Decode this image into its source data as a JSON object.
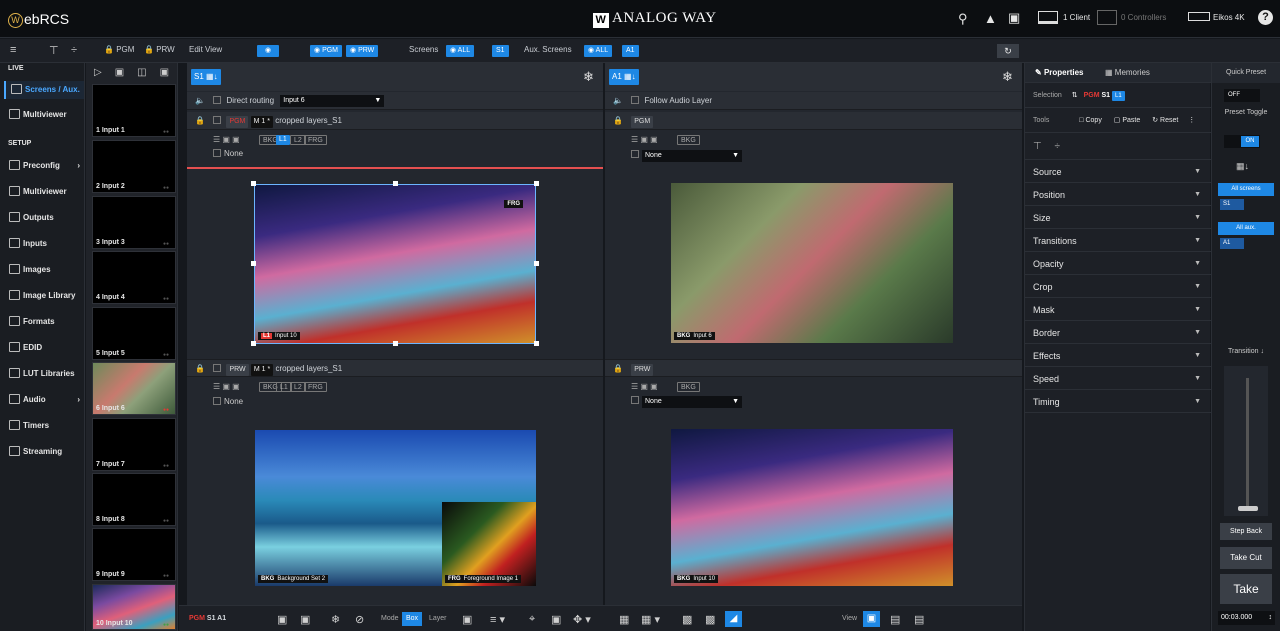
{
  "app": {
    "name": "ebRCS",
    "brand": "ANALOG WAY",
    "clients": "1 Client",
    "controllers": "0 Controllers",
    "device": "Eikos 4K"
  },
  "toolbar": {
    "pgm": "PGM",
    "prw": "PRW",
    "edit_view": "Edit View",
    "pgm_btn": "PGM",
    "prw_btn": "PRW",
    "screens_label": "Screens",
    "all": "ALL",
    "s1": "S1",
    "aux_label": "Aux. Screens",
    "aux_all": "ALL",
    "a1": "A1"
  },
  "nav": {
    "live": "LIVE",
    "setup": "SETUP",
    "items": [
      {
        "label": "Screens / Aux."
      },
      {
        "label": "Multiviewer"
      },
      {
        "label": "Preconfig"
      },
      {
        "label": "Multiviewer"
      },
      {
        "label": "Outputs"
      },
      {
        "label": "Inputs"
      },
      {
        "label": "Images"
      },
      {
        "label": "Image Library"
      },
      {
        "label": "Formats"
      },
      {
        "label": "EDID"
      },
      {
        "label": "LUT Libraries"
      },
      {
        "label": "Audio"
      },
      {
        "label": "Timers"
      },
      {
        "label": "Streaming"
      }
    ]
  },
  "inputs": [
    "1 Input 1",
    "2 Input 2",
    "3 Input 3",
    "4 Input 4",
    "5 Input 5",
    "6 Input 6",
    "7 Input 7",
    "8 Input 8",
    "9 Input 9",
    "10 Input 10"
  ],
  "s1": {
    "title": "S1",
    "routing": "Direct routing",
    "routing_value": "Input 6",
    "pgm": "PGM",
    "mem": "M 1 *",
    "mem_name": "cropped layers_S1",
    "layers": [
      "BKG",
      "L1",
      "L2",
      "FRG"
    ],
    "none": "None",
    "frg": "FRG",
    "l1": "L1",
    "l1_input": "Input 10",
    "prw": "PRW",
    "prw_mem": "M 1 *",
    "prw_mem_name": "cropped layers_S1",
    "prw_none": "None",
    "bkg": "BKG",
    "bkg_name": "Background Set 2",
    "frg_name": "Foreground Image 1"
  },
  "a1": {
    "title": "A1",
    "follow": "Follow Audio Layer",
    "pgm": "PGM",
    "bkg": "BKG",
    "none": "None",
    "bkg_input": "Input 6",
    "prw": "PRW",
    "prw_none": "None",
    "prw_bkg_input": "Input 10"
  },
  "props": {
    "tab_properties": "Properties",
    "tab_memories": "Memories",
    "selection": "Selection",
    "sel_pgm": "PGM",
    "sel_s1": "S1",
    "sel_l1": "L1",
    "tools": "Tools",
    "copy": "Copy",
    "paste": "Paste",
    "reset": "Reset",
    "sections": [
      "Source",
      "Position",
      "Size",
      "Transitions",
      "Opacity",
      "Crop",
      "Mask",
      "Border",
      "Effects",
      "Speed",
      "Timing"
    ]
  },
  "quick": {
    "title": "Quick Preset",
    "off": "OFF",
    "toggle": "Preset Toggle",
    "on": "ON",
    "all_screens": "All screens",
    "s1": "S1",
    "all_aux": "All aux.",
    "a1": "A1",
    "transition": "Transition",
    "step_back": "Step Back",
    "take_cut": "Take Cut",
    "take": "Take",
    "time": "00:03.000"
  },
  "bottom": {
    "pgm": "PGM",
    "screens": "S1 A1",
    "mode": "Mode",
    "box": "Box",
    "layer": "Layer",
    "view": "View"
  }
}
